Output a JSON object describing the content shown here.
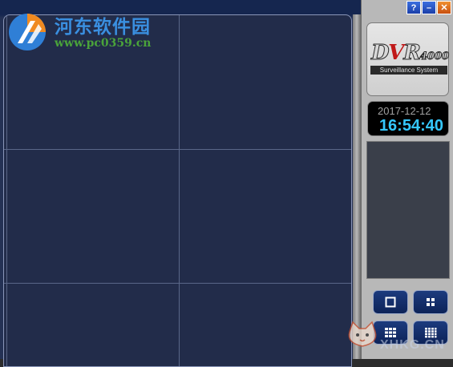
{
  "watermark": {
    "title": "河东软件园",
    "url": "www.pc0359.cn",
    "bottom_text": "XHKG.CN"
  },
  "titlebar": {
    "help": "?",
    "minimize": "–",
    "close": "✕"
  },
  "logo": {
    "brand_d": "D",
    "brand_v": "V",
    "brand_r": "R",
    "model": "4000",
    "subtitle": "Surveillance System"
  },
  "clock": {
    "date": "2017-12-12",
    "time": "16:54:40"
  },
  "layout_buttons": [
    {
      "name": "single-view",
      "icon": "single-square-icon"
    },
    {
      "name": "quad-view",
      "icon": "quad-grid-icon"
    },
    {
      "name": "nine-view",
      "icon": "nine-grid-icon"
    },
    {
      "name": "sixteen-view",
      "icon": "sixteen-grid-icon"
    }
  ],
  "colors": {
    "video_bg": "#222c4a",
    "grid_line": "#5a6788",
    "clock_time": "#35c8ff",
    "brand_red": "#c01818"
  }
}
